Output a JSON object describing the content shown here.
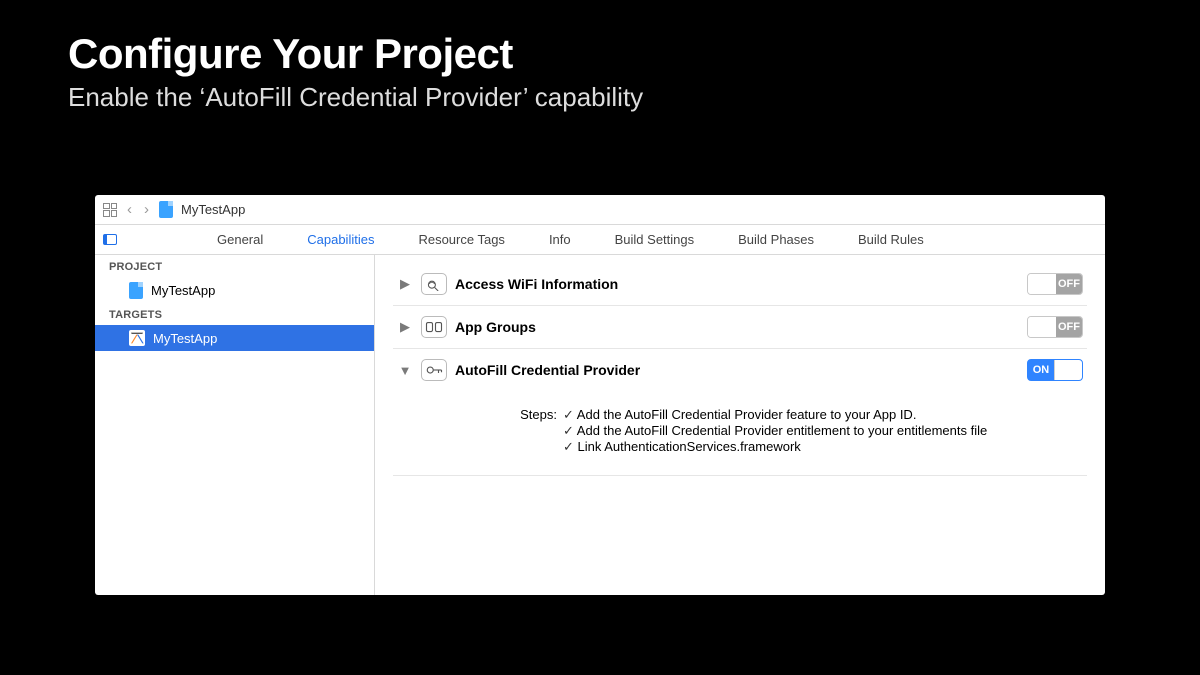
{
  "slide": {
    "title": "Configure Your Project",
    "subtitle": "Enable the ‘AutoFill Credential Provider’ capability"
  },
  "pathbar": {
    "project_name": "MyTestApp"
  },
  "tabs": {
    "general": "General",
    "capabilities": "Capabilities",
    "resource_tags": "Resource Tags",
    "info": "Info",
    "build_settings": "Build Settings",
    "build_phases": "Build Phases",
    "build_rules": "Build Rules"
  },
  "sidebar": {
    "project_header": "PROJECT",
    "project_name": "MyTestApp",
    "targets_header": "TARGETS",
    "target_name": "MyTestApp"
  },
  "caps": {
    "wifi": {
      "title": "Access WiFi Information",
      "toggle": "OFF"
    },
    "groups": {
      "title": "App Groups",
      "toggle": "OFF"
    },
    "autofill": {
      "title": "AutoFill Credential Provider",
      "toggle": "ON"
    }
  },
  "steps": {
    "label": "Steps:",
    "s1": "Add the AutoFill Credential Provider feature to your App ID.",
    "s2": "Add the AutoFill Credential Provider entitlement to your entitlements file",
    "s3": "Link AuthenticationServices.framework"
  }
}
